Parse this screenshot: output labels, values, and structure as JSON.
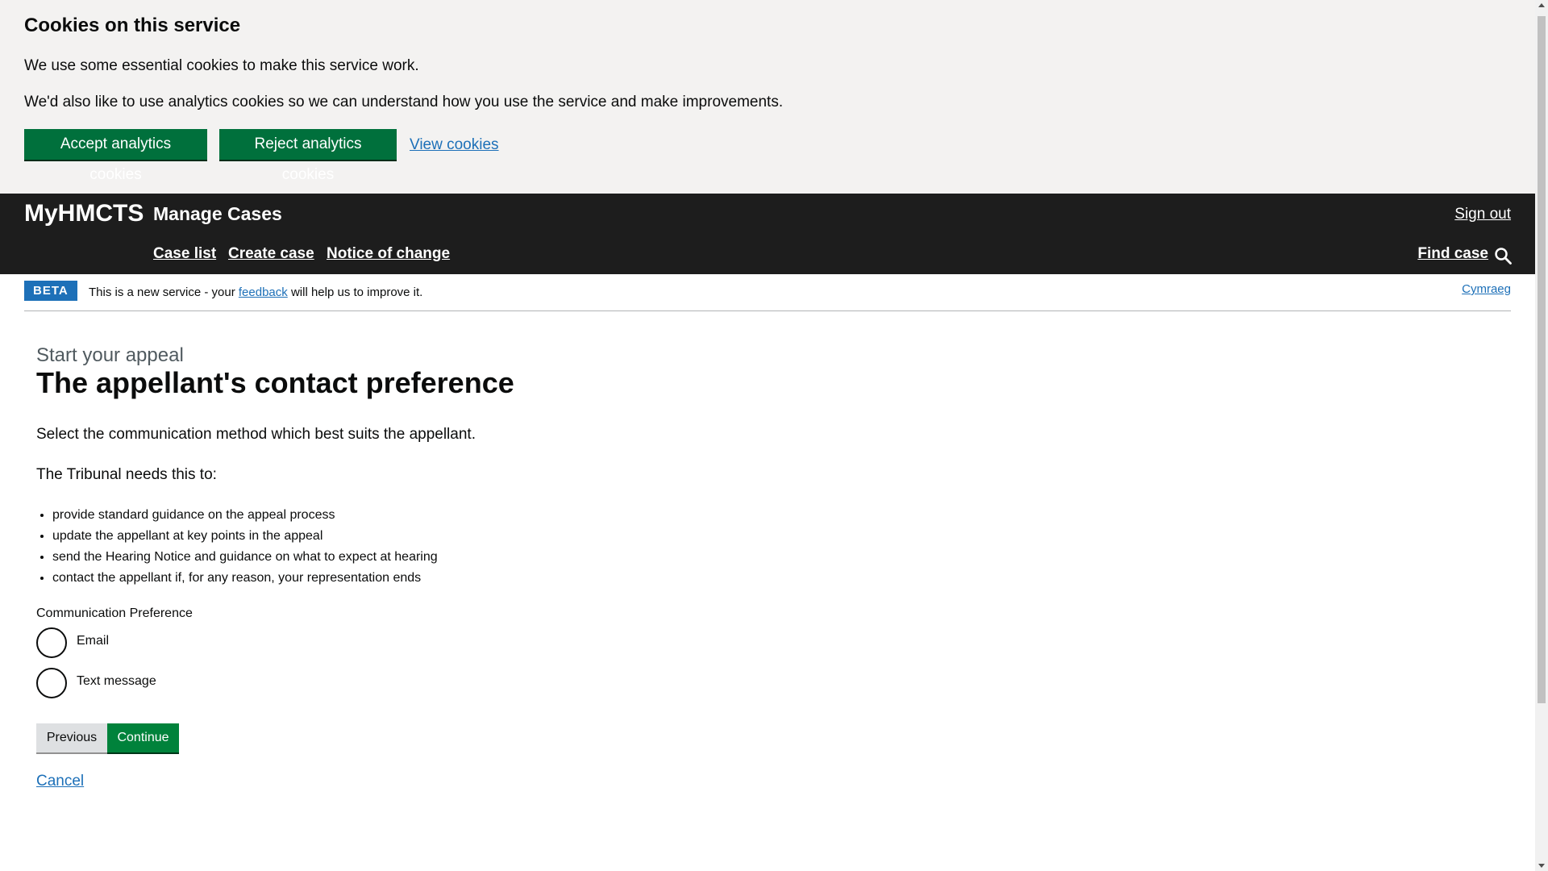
{
  "cookie_banner": {
    "title": "Cookies on this service",
    "paragraph_1": "We use some essential cookies to make this service work.",
    "paragraph_2": "We'd also like to use analytics cookies so we can understand how you use the service and make improvements.",
    "accept_label": "Accept analytics cookies",
    "reject_label": "Reject analytics cookies",
    "view_label": "View cookies"
  },
  "header": {
    "brand": "MyHMCTS",
    "service_name": "Manage Cases",
    "sign_out": "Sign out",
    "nav": [
      {
        "label": "Case list"
      },
      {
        "label": "Create case"
      },
      {
        "label": "Notice of change"
      }
    ],
    "find_case": "Find case",
    "search_icon": "search-icon"
  },
  "beta_banner": {
    "tag": "BETA",
    "text_before": "This is a new service - your ",
    "link": "feedback",
    "text_after": " will help us to improve it.",
    "language_link": "Cymraeg"
  },
  "main": {
    "caption": "Start your appeal",
    "title": "The appellant's contact preference",
    "intro": "Select the communication method which best suits the appellant.",
    "needs_heading": "The Tribunal needs this to:",
    "bullets": [
      "provide standard guidance on the appeal process",
      "update the appellant at key points in the appeal",
      "send the Hearing Notice and guidance on what to expect at hearing",
      "contact the appellant if, for any reason, your representation ends"
    ],
    "preference_label": "Communication Preference",
    "options": [
      {
        "label": "Email",
        "selected": false
      },
      {
        "label": "Text message",
        "selected": false
      }
    ],
    "previous_label": "Previous",
    "continue_label": "Continue",
    "cancel_label": "Cancel"
  },
  "colors": {
    "accent_green": "#00703c",
    "header_bg": "#1d1d1d",
    "link_blue": "#1d70b8",
    "banner_bg": "#f3f2f1"
  }
}
